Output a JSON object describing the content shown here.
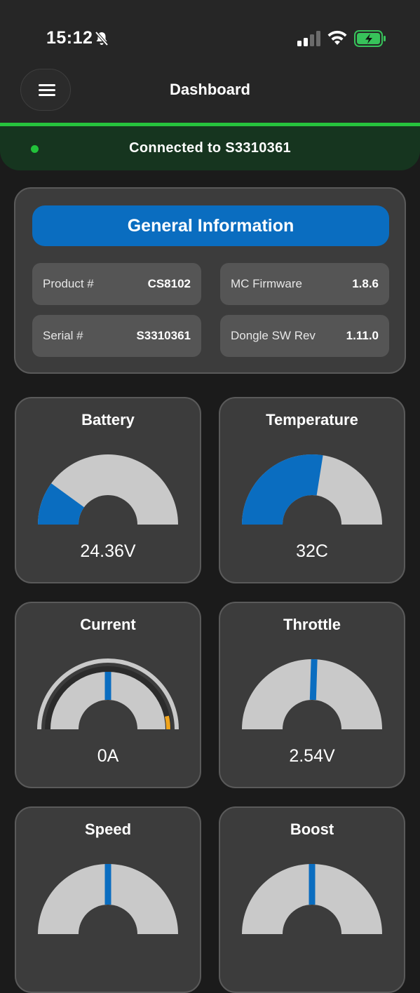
{
  "status_bar": {
    "time": "15:12",
    "icons": [
      "bell-slash-icon",
      "cellular-signal-icon",
      "wifi-icon",
      "battery-charging-icon"
    ]
  },
  "nav": {
    "title": "Dashboard",
    "menu_icon": "hamburger-menu-icon"
  },
  "connection": {
    "text": "Connected to S3310361",
    "status_color": "#22c23a"
  },
  "general_info": {
    "title": "General Information",
    "fields": [
      {
        "label": "Product #",
        "value": "CS8102"
      },
      {
        "label": "MC Firmware",
        "value": "1.8.6"
      },
      {
        "label": "Serial #",
        "value": "S3310361"
      },
      {
        "label": "Dongle SW Rev",
        "value": "1.11.0"
      }
    ]
  },
  "gauges": [
    {
      "title": "Battery",
      "value": "24.36V",
      "style": "fill",
      "level": 0.2
    },
    {
      "title": "Temperature",
      "value": "32C",
      "style": "fill",
      "level": 0.55
    },
    {
      "title": "Current",
      "value": "0A",
      "style": "needle-ring",
      "level": 0.5
    },
    {
      "title": "Throttle",
      "value": "2.54V",
      "style": "needle",
      "level": 0.51
    },
    {
      "title": "Speed",
      "value": "",
      "style": "needle",
      "level": 0.5
    },
    {
      "title": "Boost",
      "value": "",
      "style": "needle",
      "level": 0.5
    }
  ],
  "colors": {
    "accent_blue": "#0a6dc0",
    "gauge_track": "#c9c9c9",
    "ring_warning": "#f0a41c",
    "card_bg": "#3c3c3c"
  }
}
